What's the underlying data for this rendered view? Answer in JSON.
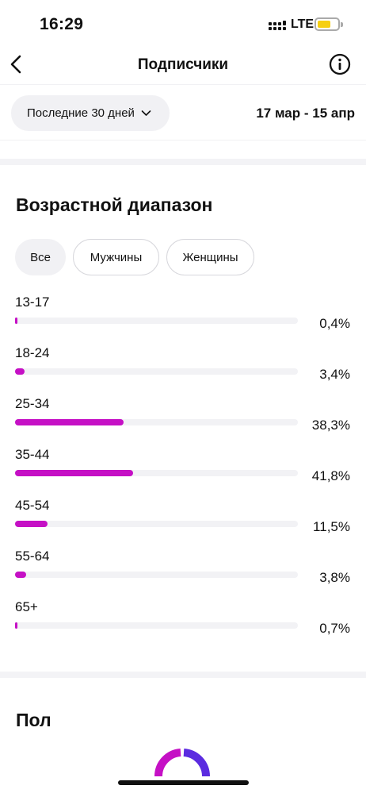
{
  "status_bar": {
    "time": "16:29",
    "network": "LTE",
    "battery_level": 0.65,
    "battery_color": "#f6cf11"
  },
  "nav": {
    "title": "Подписчики",
    "back_icon": "chevron-left-icon",
    "info_icon": "info-icon"
  },
  "filter": {
    "period_label": "Последние 30 дней",
    "period_icon": "chevron-down-icon",
    "date_range": "17 мар - 15 апр"
  },
  "age_section": {
    "title": "Возрастной диапазон",
    "tabs": [
      {
        "label": "Все",
        "selected": true
      },
      {
        "label": "Мужчины",
        "selected": false
      },
      {
        "label": "Женщины",
        "selected": false
      }
    ],
    "bar_color": "#c510c5",
    "ranges": [
      {
        "label": "13-17",
        "percent_text": "0,4%",
        "percent": 0.4
      },
      {
        "label": "18-24",
        "percent_text": "3,4%",
        "percent": 3.4
      },
      {
        "label": "25-34",
        "percent_text": "38,3%",
        "percent": 38.3
      },
      {
        "label": "35-44",
        "percent_text": "41,8%",
        "percent": 41.8
      },
      {
        "label": "45-54",
        "percent_text": "11,5%",
        "percent": 11.5
      },
      {
        "label": "55-64",
        "percent_text": "3,8%",
        "percent": 3.8
      },
      {
        "label": "65+",
        "percent_text": "0,7%",
        "percent": 0.7
      }
    ]
  },
  "gender_section": {
    "title": "Пол",
    "colors": [
      "#c510c5",
      "#5b2be0"
    ]
  }
}
